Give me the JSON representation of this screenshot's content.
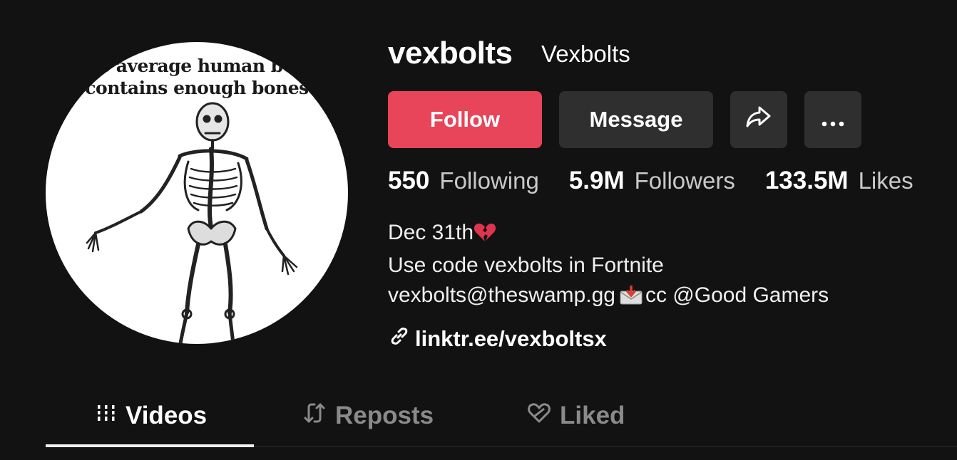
{
  "profile": {
    "username": "vexbolts",
    "nickname": "Vexbolts",
    "avatar_caption_line1": "e average human bo",
    "avatar_caption_line2": "contains enough bones"
  },
  "actions": {
    "follow_label": "Follow",
    "message_label": "Message",
    "share_icon": "share-arrow-icon",
    "more_icon": "more-dots-icon",
    "follow_color": "#e8445a"
  },
  "stats": {
    "following_count": "550",
    "following_label": "Following",
    "followers_count": "5.9M",
    "followers_label": "Followers",
    "likes_count": "133.5M",
    "likes_label": "Likes"
  },
  "bio": {
    "line1": "Dec 31th",
    "line1_emoji": "broken-heart",
    "line2": "Use code vexbolts in Fortnite",
    "line3_email": "vexbolts@theswamp.gg",
    "line3_emoji": "envelope-with-arrow",
    "line3_suffix": "cc @Good Gamers"
  },
  "link": {
    "text": "linktr.ee/vexboltsx",
    "icon": "link-icon"
  },
  "tabs": [
    {
      "label": "Videos",
      "icon": "videos-grid-icon",
      "active": true
    },
    {
      "label": "Reposts",
      "icon": "repost-icon",
      "active": false
    },
    {
      "label": "Liked",
      "icon": "liked-heart-icon",
      "active": false
    }
  ]
}
